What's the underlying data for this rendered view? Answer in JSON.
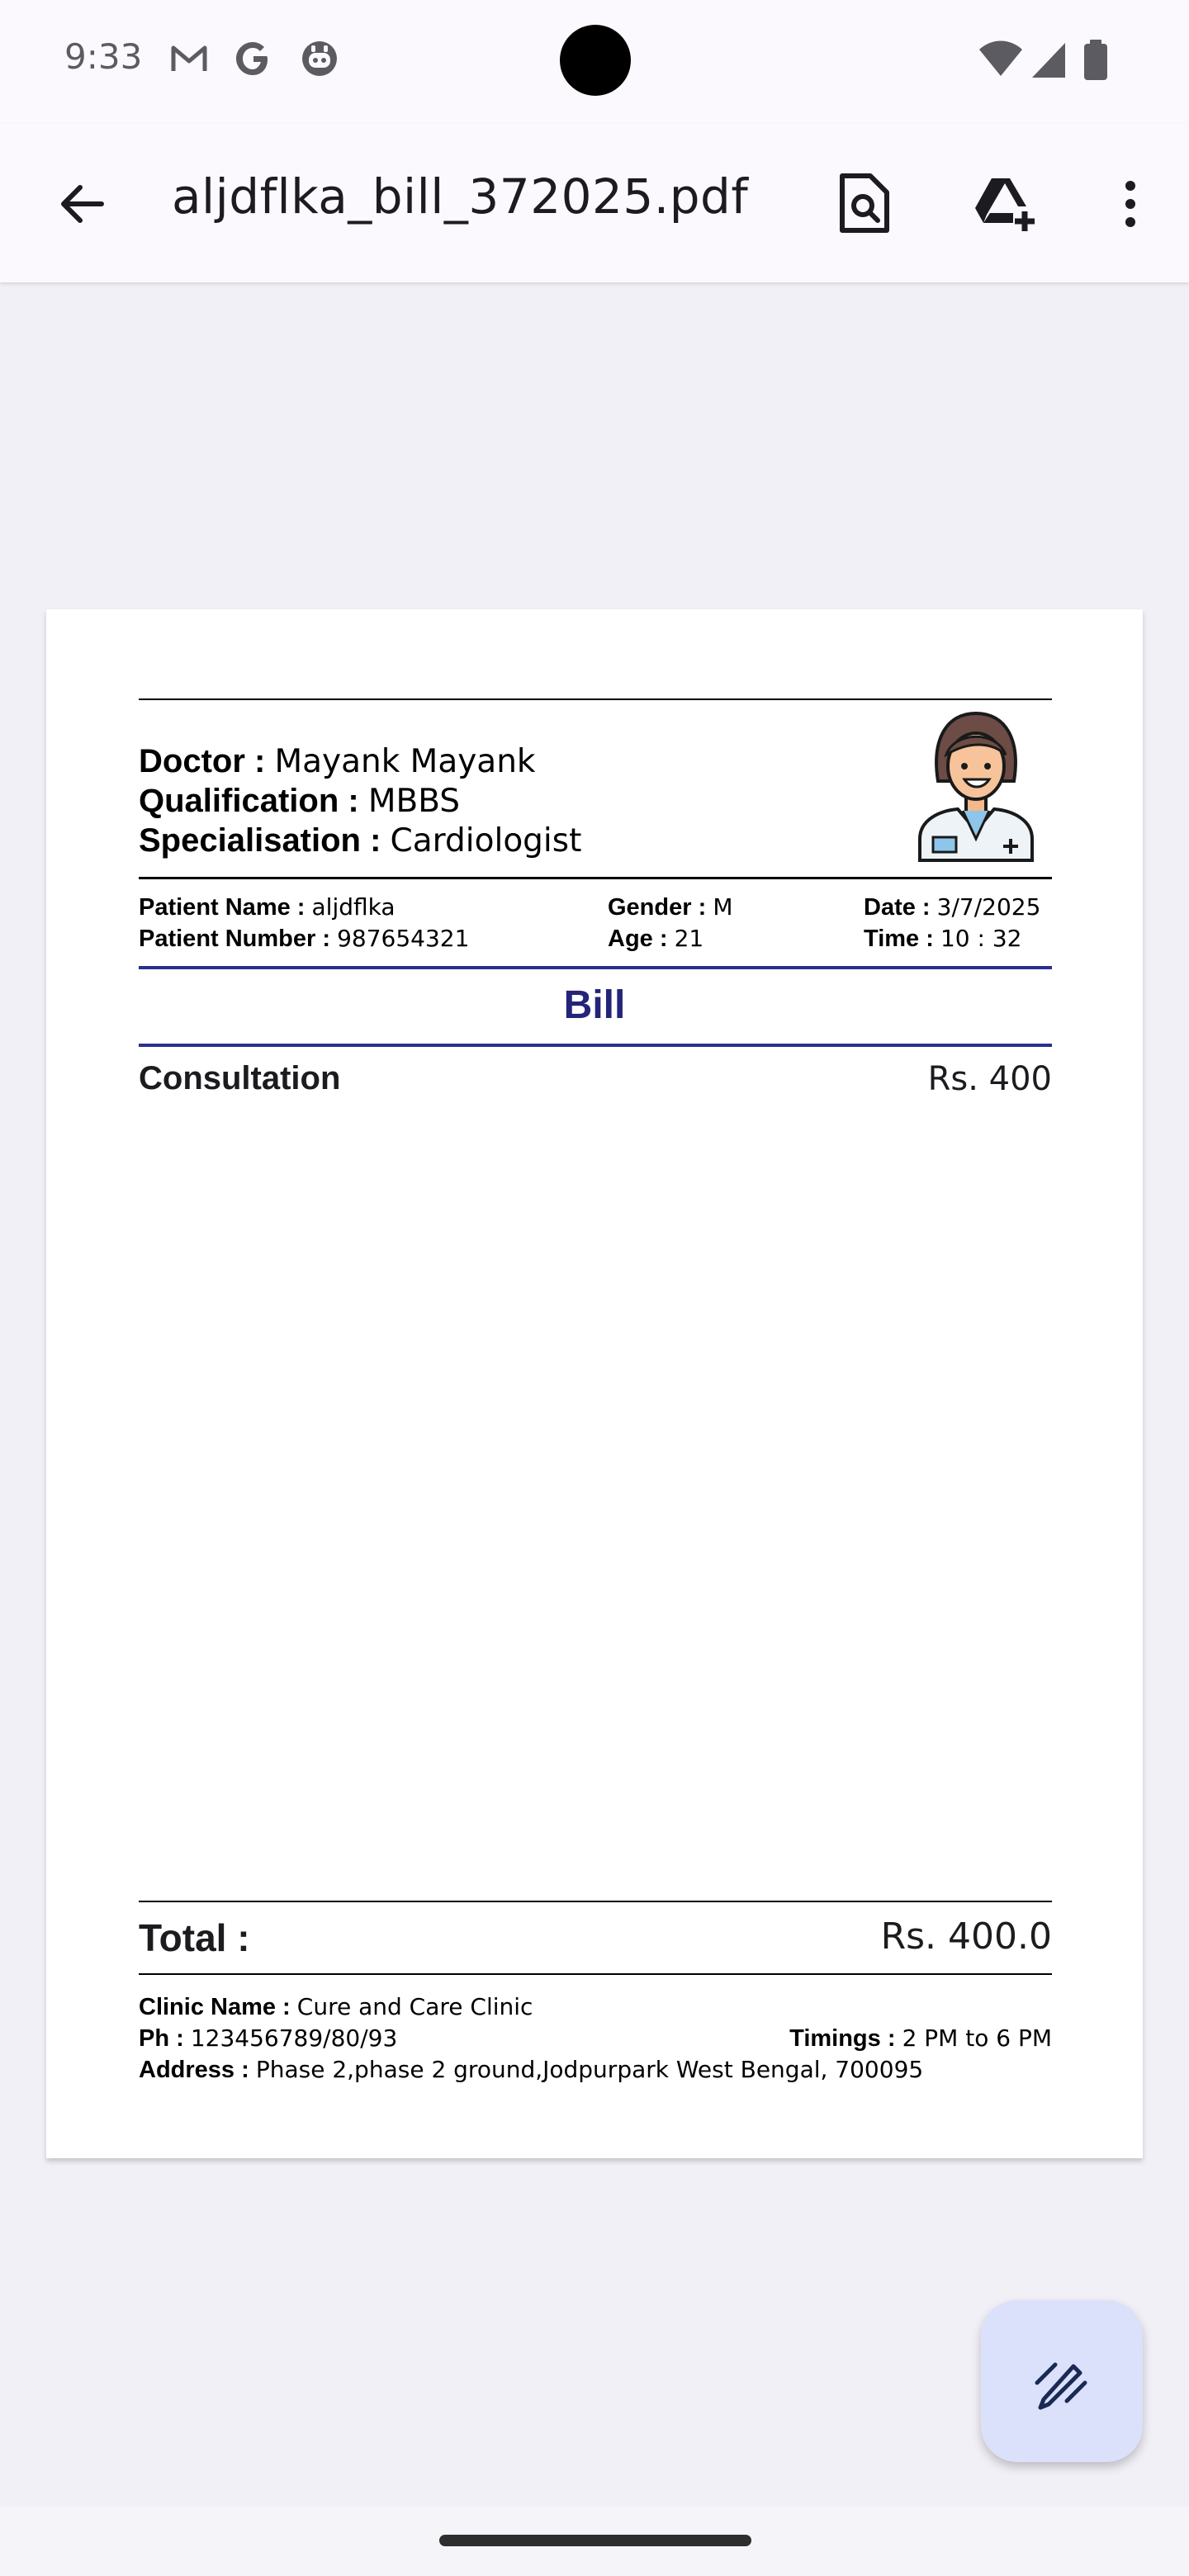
{
  "status_bar": {
    "time": "9:33",
    "notification_icons": [
      "gmail-icon",
      "google-icon",
      "bot-icon"
    ],
    "system_icons": [
      "wifi-icon",
      "signal-icon",
      "battery-icon"
    ]
  },
  "toolbar": {
    "back_icon": "arrow-back-icon",
    "title": "aljdflka_bill_372025.pdf",
    "actions": [
      "find-in-document-icon",
      "add-to-drive-icon",
      "more-vert-icon"
    ]
  },
  "bill": {
    "doctor_label": "Doctor :",
    "doctor_value": "Mayank Mayank",
    "qualification_label": "Qualification :",
    "qualification_value": "MBBS",
    "specialisation_label": "Specialisation :",
    "specialisation_value": "Cardiologist",
    "patient_name_label": "Patient Name :",
    "patient_name_value": "aljdflka",
    "patient_number_label": "Patient Number :",
    "patient_number_value": "987654321",
    "gender_label": "Gender :",
    "gender_value": "M",
    "age_label": "Age :",
    "age_value": "21",
    "date_label": "Date :",
    "date_value": "3/7/2025",
    "time_label": "Time :",
    "time_value": "10 : 32",
    "title": "Bill",
    "items": [
      {
        "name": "Consultation",
        "amount": "Rs. 400"
      }
    ],
    "total_label": "Total :",
    "total_amount": "Rs. 400.0",
    "clinic_name_label": "Clinic Name :",
    "clinic_name_value": "Cure and Care Clinic",
    "phone_label": "Ph :",
    "phone_value": "123456789/80/93",
    "timings_label": "Timings :",
    "timings_value": "2 PM to 6 PM",
    "address_label": "Address :",
    "address_value": "Phase 2,phase 2 ground,Jodpurpark West Bengal, 700095"
  },
  "fab": {
    "icon": "edit-pen-icon"
  },
  "colors": {
    "bill_title": "#24247a",
    "blue_rule": "#2b2f8e",
    "fab_bg": "#dbe1fa",
    "app_bar_bg": "#fbf9fe",
    "viewer_bg": "#f1f0f7"
  }
}
